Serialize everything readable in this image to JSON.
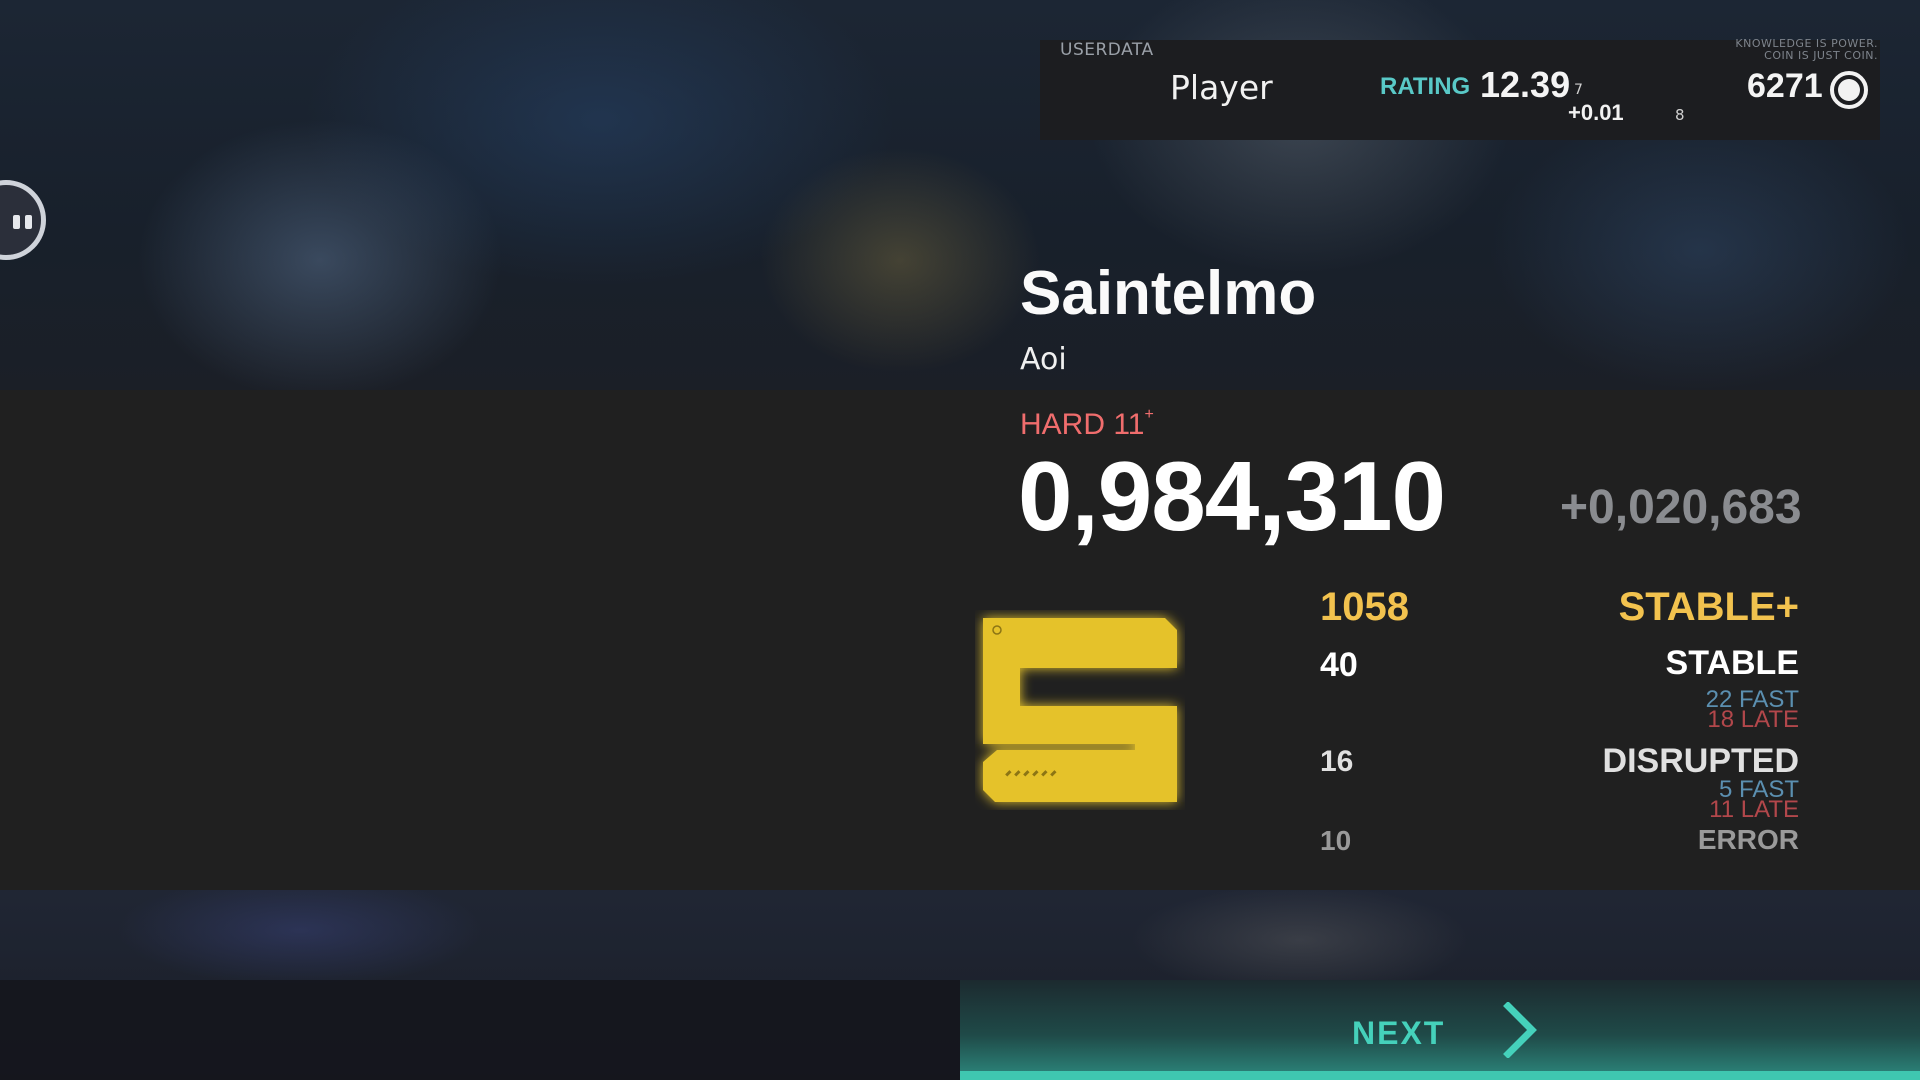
{
  "userdata": {
    "label": "USERDATA",
    "motto_line1": "KNOWLEDGE IS POWER.",
    "motto_line2": "COIN IS JUST COIN.",
    "player_name": "Player",
    "rating_label": "RATING",
    "rating": "12.39",
    "rating_sub": "7",
    "rating_delta": "+0.01",
    "rating_delta_sub": "8",
    "coins": "6271",
    "coin_icon": "coin-icon"
  },
  "song": {
    "title": "Saintelmo",
    "artist": "Aoi",
    "difficulty": "HARD 11",
    "difficulty_plus": "+"
  },
  "result": {
    "score": "0,984,310",
    "score_delta": "+0,020,683",
    "grade": "S",
    "grade_color": "#e5c22a"
  },
  "judgements": [
    {
      "count": "1058",
      "label": "STABLE+",
      "color": "#f2c24e"
    },
    {
      "count": "40",
      "label": "STABLE",
      "color": "#ffffff",
      "fast": "22 FAST",
      "late": "18 LATE"
    },
    {
      "count": "16",
      "label": "DISRUPTED",
      "color": "#e0e0e0",
      "fast": "5 FAST",
      "late": "11 LATE"
    },
    {
      "count": "10",
      "label": "ERROR",
      "color": "#9a9a9a"
    }
  ],
  "colors": {
    "fast": "#5b8fb0",
    "late": "#b2474b",
    "accent": "#45d1bb"
  },
  "controls": {
    "pause_icon": "pause-icon",
    "next_label": "NEXT",
    "next_icon": "chevron-right-icon"
  }
}
